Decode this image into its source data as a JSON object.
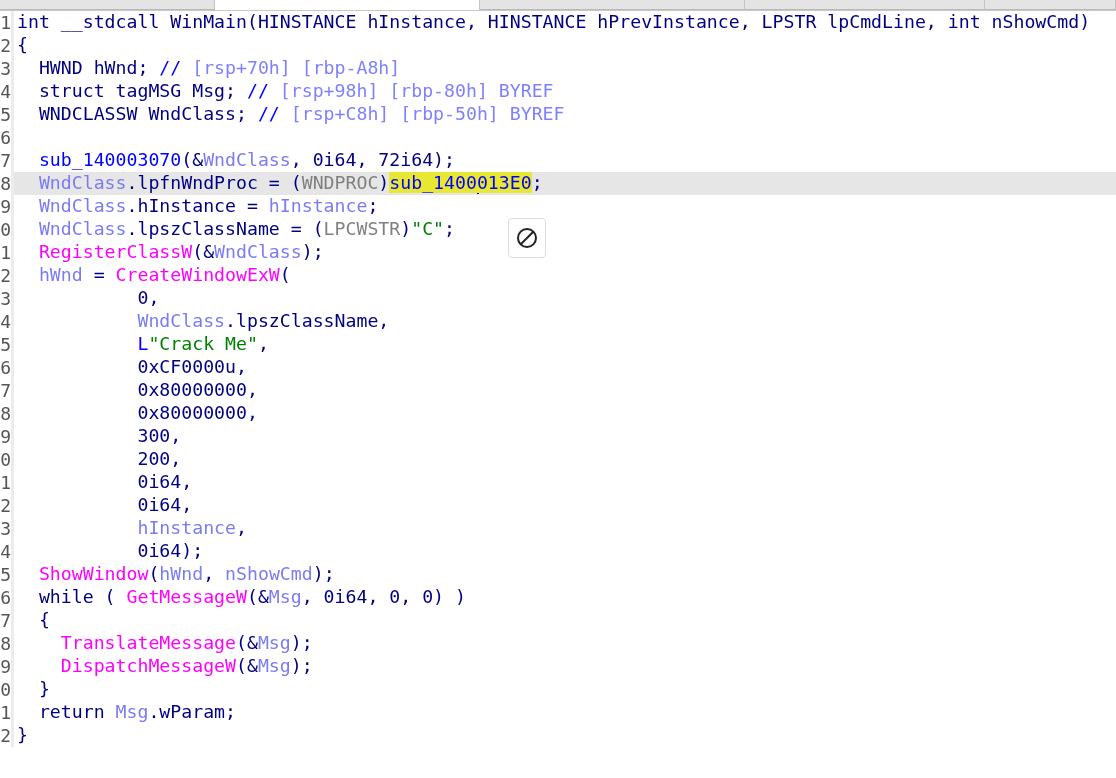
{
  "tabs": [
    {
      "selected": false
    },
    {
      "selected": true
    },
    {
      "selected": false
    },
    {
      "selected": false
    },
    {
      "selected": false
    }
  ],
  "lines": [
    {
      "number": "1",
      "selected": false,
      "tokens": [
        {
          "text": "int __stdcall WinMain(HINSTANCE hInstance, HINSTANCE hPrevInstance, LPSTR lpCmdLine, int nShowCmd)",
          "kind": "plain"
        }
      ]
    },
    {
      "number": "2",
      "selected": false,
      "tokens": [
        {
          "text": "{",
          "kind": "plain"
        }
      ]
    },
    {
      "number": "3",
      "selected": false,
      "tokens": [
        {
          "text": "  HWND hWnd; ",
          "kind": "plain"
        },
        {
          "text": "// ",
          "kind": "comment"
        },
        {
          "text": "[rsp+70h] [rbp-A8h]",
          "kind": "note"
        }
      ]
    },
    {
      "number": "4",
      "selected": false,
      "tokens": [
        {
          "text": "  struct tagMSG Msg; ",
          "kind": "plain"
        },
        {
          "text": "// ",
          "kind": "comment"
        },
        {
          "text": "[rsp+98h] [rbp-80h] BYREF",
          "kind": "note"
        }
      ]
    },
    {
      "number": "5",
      "selected": false,
      "tokens": [
        {
          "text": "  WNDCLASSW WndClass; ",
          "kind": "plain"
        },
        {
          "text": "// ",
          "kind": "comment"
        },
        {
          "text": "[rsp+C8h] [rbp-50h] BYREF",
          "kind": "note"
        }
      ]
    },
    {
      "number": "6",
      "selected": false
    },
    {
      "number": "7",
      "selected": false,
      "tokens": [
        {
          "text": "  sub_140003070",
          "kind": "sub"
        },
        {
          "text": "(&",
          "kind": "plain"
        },
        {
          "text": "WndClass",
          "kind": "var"
        },
        {
          "text": ", 0i64, 72i64);",
          "kind": "plain"
        }
      ]
    },
    {
      "number": "8",
      "selected": true,
      "tokens": [
        {
          "text": "  WndClass",
          "kind": "var"
        },
        {
          "text": ".lpfnWndProc = (",
          "kind": "plain"
        },
        {
          "text": "WNDPROC",
          "kind": "cast"
        },
        {
          "text": ")",
          "kind": "plain"
        },
        {
          "text": "sub_1400",
          "kind": "highlight"
        },
        {
          "text": "013E0",
          "kind": "highlight",
          "caret": true
        },
        {
          "text": ";",
          "kind": "plain"
        }
      ]
    },
    {
      "number": "9",
      "selected": false,
      "tokens": [
        {
          "text": "  WndClass",
          "kind": "var"
        },
        {
          "text": ".hInstance = ",
          "kind": "plain"
        },
        {
          "text": "hInstance",
          "kind": "var"
        },
        {
          "text": ";",
          "kind": "plain"
        }
      ]
    },
    {
      "number": "0",
      "selected": false,
      "tokens": [
        {
          "text": "  WndClass",
          "kind": "var"
        },
        {
          "text": ".lpszClassName = (",
          "kind": "plain"
        },
        {
          "text": "LPCWSTR",
          "kind": "cast"
        },
        {
          "text": ")",
          "kind": "plain"
        },
        {
          "text": "\"C\"",
          "kind": "string"
        },
        {
          "text": ";",
          "kind": "plain"
        }
      ]
    },
    {
      "number": "1",
      "selected": false,
      "tokens": [
        {
          "text": "  RegisterClassW",
          "kind": "func"
        },
        {
          "text": "(&",
          "kind": "plain"
        },
        {
          "text": "WndClass",
          "kind": "var"
        },
        {
          "text": ");",
          "kind": "plain"
        }
      ]
    },
    {
      "number": "2",
      "selected": false,
      "tokens": [
        {
          "text": "  hWnd",
          "kind": "var"
        },
        {
          "text": " = ",
          "kind": "plain"
        },
        {
          "text": "CreateWindowExW",
          "kind": "func"
        },
        {
          "text": "(",
          "kind": "plain"
        }
      ]
    },
    {
      "number": "3",
      "selected": false,
      "tokens": [
        {
          "text": "           0,",
          "kind": "plain"
        }
      ]
    },
    {
      "number": "4",
      "selected": false,
      "tokens": [
        {
          "text": "           WndClass",
          "kind": "var"
        },
        {
          "text": ".lpszClassName,",
          "kind": "plain"
        }
      ]
    },
    {
      "number": "5",
      "selected": false,
      "tokens": [
        {
          "text": "           L",
          "kind": "sub"
        },
        {
          "text": "\"Crack Me\"",
          "kind": "string"
        },
        {
          "text": ",",
          "kind": "plain"
        }
      ]
    },
    {
      "number": "6",
      "selected": false,
      "tokens": [
        {
          "text": "           0xCF0000u,",
          "kind": "plain"
        }
      ]
    },
    {
      "number": "7",
      "selected": false,
      "tokens": [
        {
          "text": "           0x80000000,",
          "kind": "plain"
        }
      ]
    },
    {
      "number": "8",
      "selected": false,
      "tokens": [
        {
          "text": "           0x80000000,",
          "kind": "plain"
        }
      ]
    },
    {
      "number": "9",
      "selected": false,
      "tokens": [
        {
          "text": "           300,",
          "kind": "plain"
        }
      ]
    },
    {
      "number": "0",
      "selected": false,
      "tokens": [
        {
          "text": "           200,",
          "kind": "plain"
        }
      ]
    },
    {
      "number": "1",
      "selected": false,
      "tokens": [
        {
          "text": "           0i64,",
          "kind": "plain"
        }
      ]
    },
    {
      "number": "2",
      "selected": false,
      "tokens": [
        {
          "text": "           0i64,",
          "kind": "plain"
        }
      ]
    },
    {
      "number": "3",
      "selected": false,
      "tokens": [
        {
          "text": "           hInstance",
          "kind": "var"
        },
        {
          "text": ",",
          "kind": "plain"
        }
      ]
    },
    {
      "number": "4",
      "selected": false,
      "tokens": [
        {
          "text": "           0i64);",
          "kind": "plain"
        }
      ]
    },
    {
      "number": "5",
      "selected": false,
      "tokens": [
        {
          "text": "  ShowWindow",
          "kind": "func"
        },
        {
          "text": "(",
          "kind": "plain"
        },
        {
          "text": "hWnd",
          "kind": "var"
        },
        {
          "text": ", ",
          "kind": "plain"
        },
        {
          "text": "nShowCmd",
          "kind": "var"
        },
        {
          "text": ");",
          "kind": "plain"
        }
      ]
    },
    {
      "number": "6",
      "selected": false,
      "tokens": [
        {
          "text": "  while ( ",
          "kind": "plain"
        },
        {
          "text": "GetMessageW",
          "kind": "func"
        },
        {
          "text": "(&",
          "kind": "plain"
        },
        {
          "text": "Msg",
          "kind": "var"
        },
        {
          "text": ", 0i64, 0, 0) )",
          "kind": "plain"
        }
      ]
    },
    {
      "number": "7",
      "selected": false,
      "tokens": [
        {
          "text": "  {",
          "kind": "plain"
        }
      ]
    },
    {
      "number": "8",
      "selected": false,
      "tokens": [
        {
          "text": "    TranslateMessage",
          "kind": "func"
        },
        {
          "text": "(&",
          "kind": "plain"
        },
        {
          "text": "Msg",
          "kind": "var"
        },
        {
          "text": ");",
          "kind": "plain"
        }
      ]
    },
    {
      "number": "9",
      "selected": false,
      "tokens": [
        {
          "text": "    DispatchMessageW",
          "kind": "func"
        },
        {
          "text": "(&",
          "kind": "plain"
        },
        {
          "text": "Msg",
          "kind": "var"
        },
        {
          "text": ");",
          "kind": "plain"
        }
      ]
    },
    {
      "number": "0",
      "selected": false,
      "tokens": [
        {
          "text": "  }",
          "kind": "plain"
        }
      ]
    },
    {
      "number": "1",
      "selected": false,
      "tokens": [
        {
          "text": "  return ",
          "kind": "plain"
        },
        {
          "text": "Msg",
          "kind": "var"
        },
        {
          "text": ".wParam;",
          "kind": "plain"
        }
      ]
    },
    {
      "number": "2",
      "selected": false,
      "tokens": [
        {
          "text": "}",
          "kind": "plain"
        }
      ]
    }
  ]
}
